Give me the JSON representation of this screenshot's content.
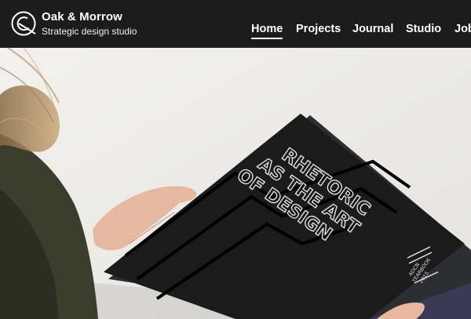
{
  "header": {
    "brand_name": "Oak & Morrow",
    "tagline": "Strategic design studio",
    "nav": [
      {
        "label": "Home",
        "active": true
      },
      {
        "label": "Projects",
        "active": false
      },
      {
        "label": "Journal",
        "active": false
      },
      {
        "label": "Studio",
        "active": false
      },
      {
        "label": "Jobs",
        "active": false
      }
    ]
  },
  "hero": {
    "book_title_line1": "RHETORIC",
    "book_title_line2": "AS THE ART",
    "book_title_line3": "OF DESIGN",
    "spine_line1": "ADCN",
    "spine_line2": "YEARBOOK",
    "spine_line3": "2015"
  },
  "colors": {
    "header_bg": "#1c1c1c",
    "hero_bg": "#ececea",
    "book": "#1b1b1b",
    "text": "#ffffff"
  }
}
